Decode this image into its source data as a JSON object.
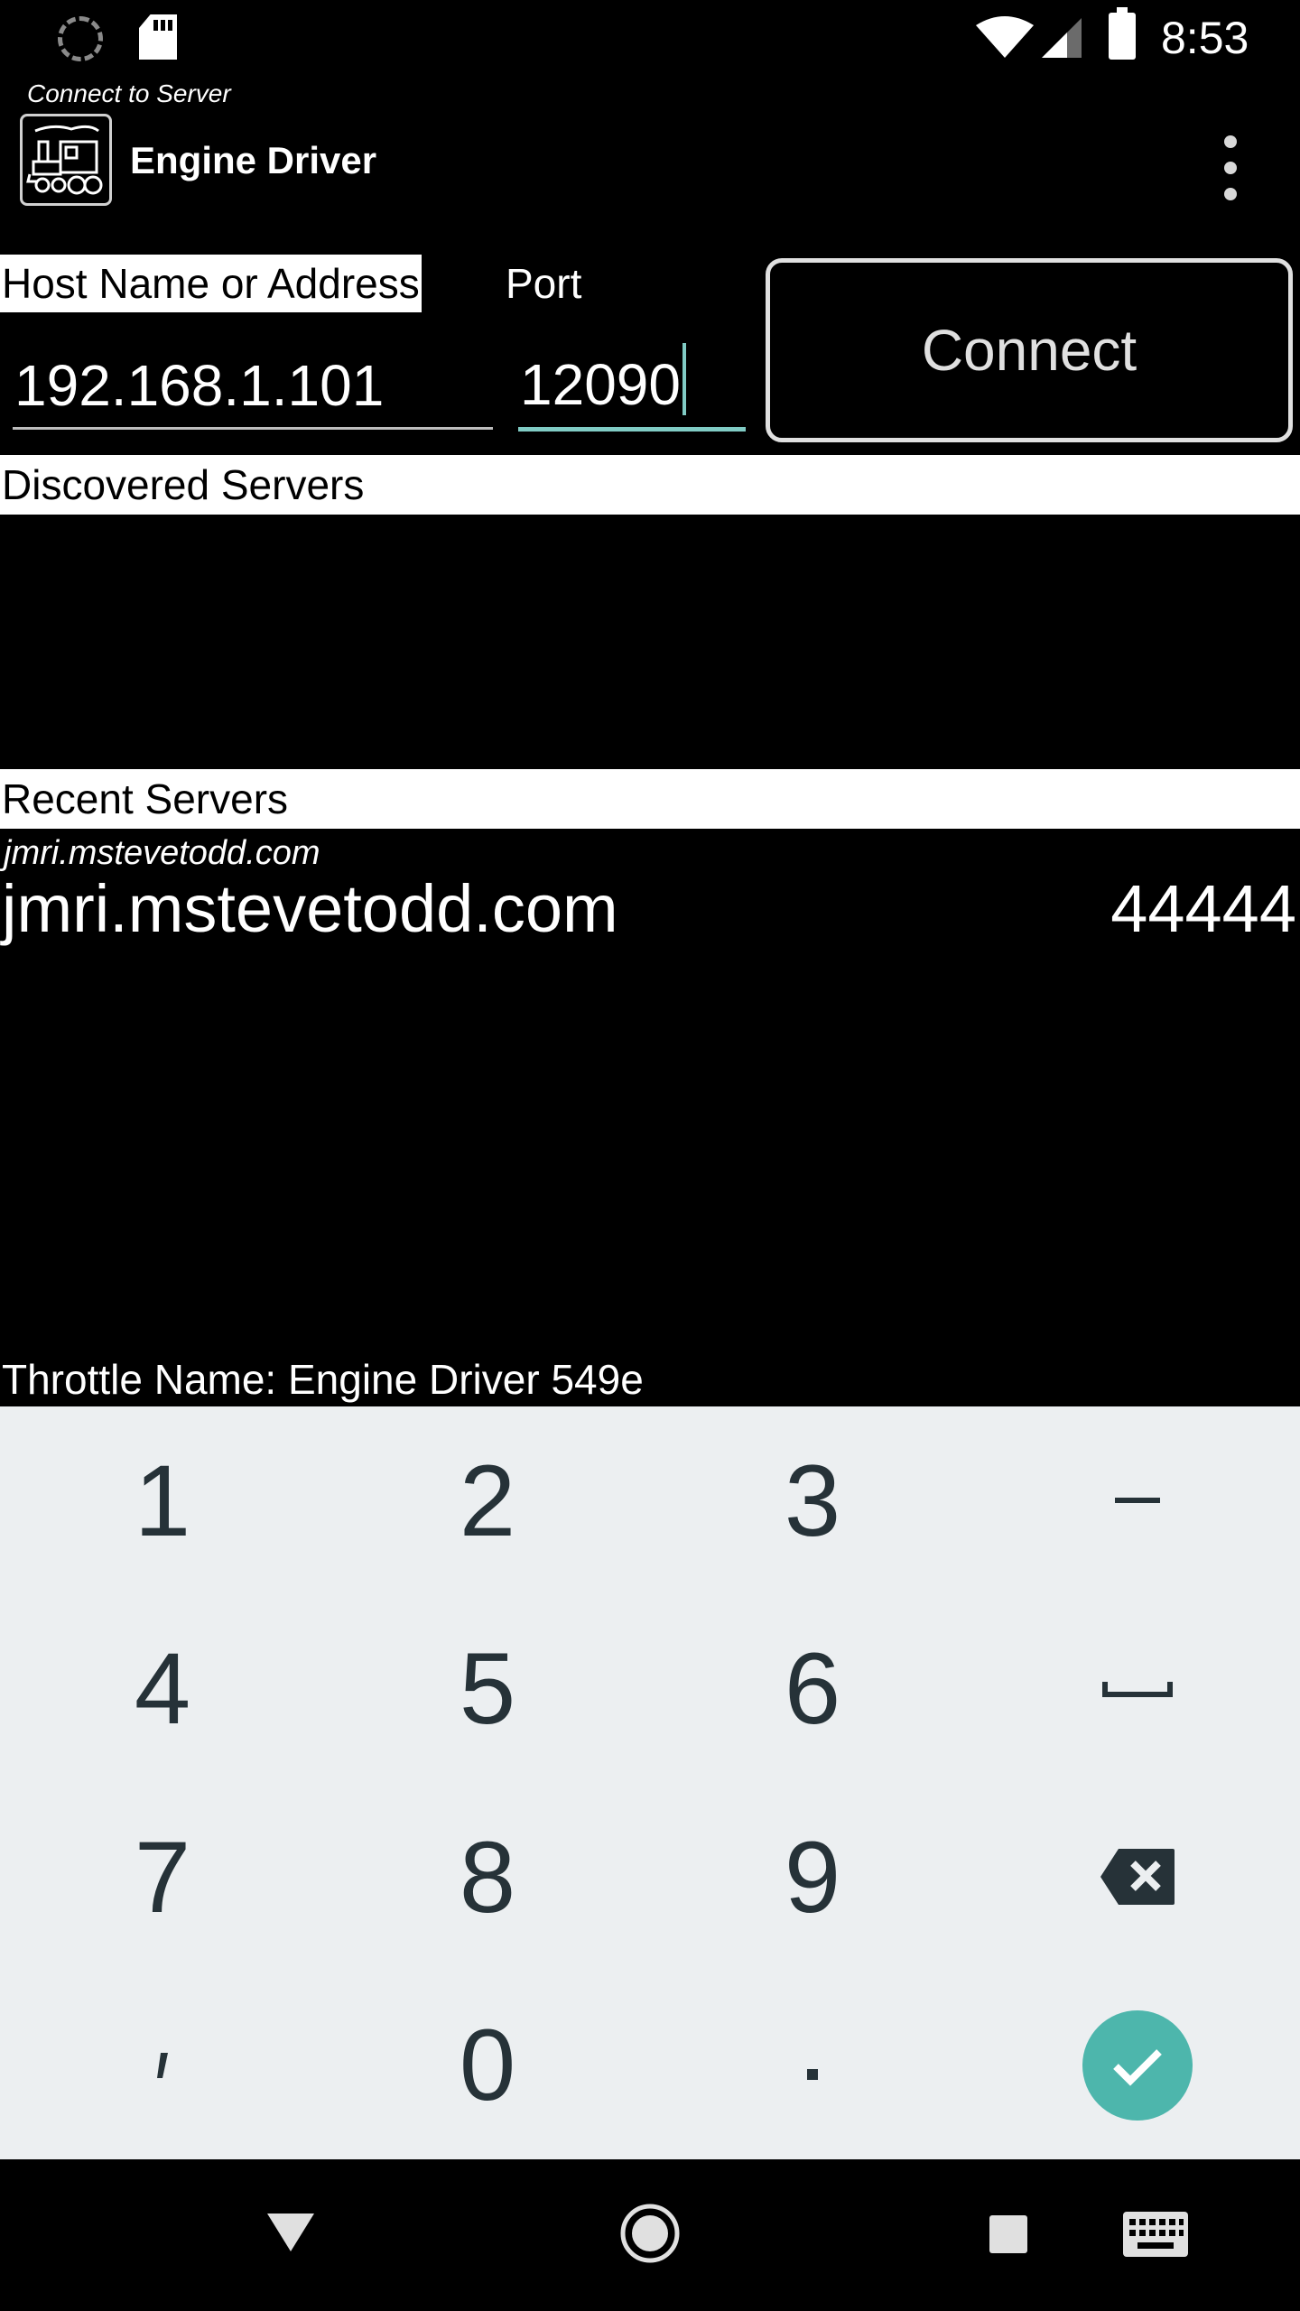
{
  "status_bar": {
    "time": "8:53",
    "icons": [
      "sync-icon",
      "sd-card-icon",
      "wifi-icon",
      "cell-signal-icon",
      "battery-icon"
    ]
  },
  "action_bar": {
    "subtitle": "Connect to Server",
    "title": "Engine Driver",
    "overflow_icon": "more-vert-icon"
  },
  "connect_form": {
    "host_label": "Host Name or Address",
    "host_value": "192.168.1.101",
    "port_label": "Port",
    "port_value": "12090",
    "connect_label": "Connect"
  },
  "discovered": {
    "header": "Discovered Servers",
    "items": []
  },
  "recent": {
    "header": "Recent Servers",
    "items": [
      {
        "name": "jmri.mstevetodd.com",
        "host": "jmri.mstevetodd.com",
        "port": "44444"
      }
    ]
  },
  "throttle_name": "Throttle Name: Engine Driver 549e",
  "keyboard": {
    "keys": [
      "1",
      "2",
      "3",
      "-",
      "4",
      "5",
      "6",
      "space",
      "7",
      "8",
      "9",
      "backspace",
      ",",
      "0",
      ".",
      "done"
    ],
    "accent": "#4db6ac"
  },
  "nav_bar": {
    "buttons": [
      "back-icon",
      "home-icon",
      "recents-icon",
      "keyboard-icon"
    ]
  }
}
